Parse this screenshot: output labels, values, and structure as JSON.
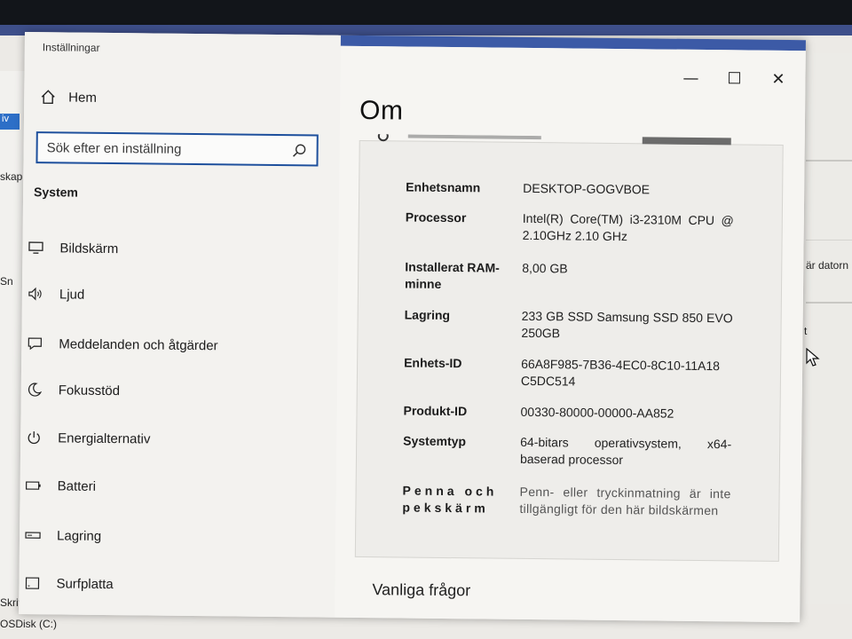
{
  "window": {
    "title": "Inställningar",
    "controls": {
      "minimize": "—",
      "maximize": "☐",
      "close": "✕"
    }
  },
  "nav": {
    "home_label": "Hem",
    "search_placeholder": "Sök efter en inställning",
    "section_label": "System",
    "items": [
      {
        "label": "Bildskärm",
        "icon": "display-icon"
      },
      {
        "label": "Ljud",
        "icon": "speaker-icon"
      },
      {
        "label": "Meddelanden och åtgärder",
        "icon": "message-icon"
      },
      {
        "label": "Fokusstöd",
        "icon": "moon-icon"
      },
      {
        "label": "Energialternativ",
        "icon": "power-icon"
      },
      {
        "label": "Batteri",
        "icon": "battery-icon"
      },
      {
        "label": "Lagring",
        "icon": "storage-icon"
      },
      {
        "label": "Surfplatta",
        "icon": "tablet-icon"
      }
    ]
  },
  "content": {
    "page_title": "Om",
    "specs": [
      {
        "key": "Enhetsnamn",
        "value": "DESKTOP-GOGVBOE"
      },
      {
        "key": "Processor",
        "value": "Intel(R) Core(TM) i3-2310M CPU @ 2.10GHz 2.10 GHz"
      },
      {
        "key": "Installerat RAM-minne",
        "value": "8,00 GB"
      },
      {
        "key": "Lagring",
        "value": "233 GB SSD Samsung SSD 850 EVO 250GB"
      },
      {
        "key": "Enhets-ID",
        "value": "66A8F985-7B36-4EC0-8C10-11A18 C5DC514"
      },
      {
        "key": "Produkt-ID",
        "value": "00330-80000-00000-AA852"
      },
      {
        "key": "Systemtyp",
        "value": "64-bitars operativsystem, x64-baserad processor"
      },
      {
        "key": "Penna och pekskärm",
        "value": "Penn- eller tryckinmatning är inte tillgängligt för den här bildskärmen"
      }
    ],
    "faq_label": "Vanliga frågor"
  },
  "background": {
    "left_labels": [
      "iv",
      "skap",
      "Sn"
    ],
    "right_label": "är datorn",
    "right_small": "t",
    "bottom_labels": [
      "Skrivbord",
      "OSDisk (C:)"
    ]
  }
}
